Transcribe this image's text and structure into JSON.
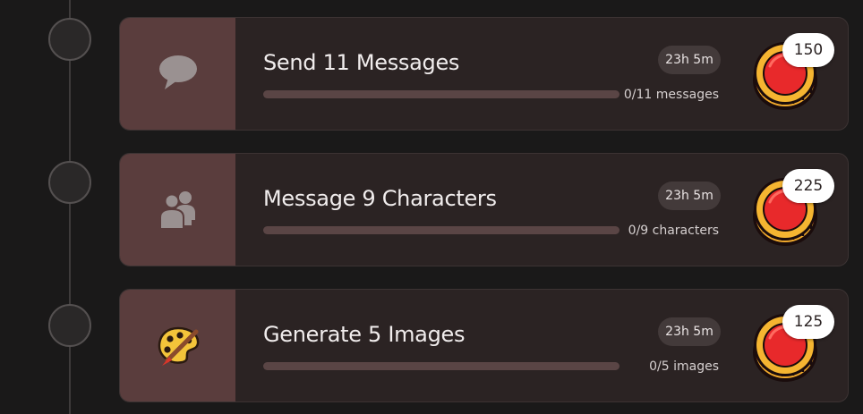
{
  "icons": {
    "coin": "coin-icon",
    "messages": "speech-bubble-icon",
    "characters": "users-icon",
    "images": "palette-icon"
  },
  "colors": {
    "background": "#1a1919",
    "card": "#2b2323",
    "icon_panel": "#5a3d3d",
    "progress_track": "#5a4545",
    "coin_red": "#e8292b",
    "coin_gold": "#f0a92c"
  },
  "quests": [
    {
      "title": "Send 11 Messages",
      "timer": "23h 5m",
      "progress_text": "0/11 messages",
      "progress": 0,
      "reward": "150"
    },
    {
      "title": "Message 9 Characters",
      "timer": "23h 5m",
      "progress_text": "0/9 characters",
      "progress": 0,
      "reward": "225"
    },
    {
      "title": "Generate 5 Images",
      "timer": "23h 5m",
      "progress_text": "0/5 images",
      "progress": 0,
      "reward": "125"
    }
  ]
}
